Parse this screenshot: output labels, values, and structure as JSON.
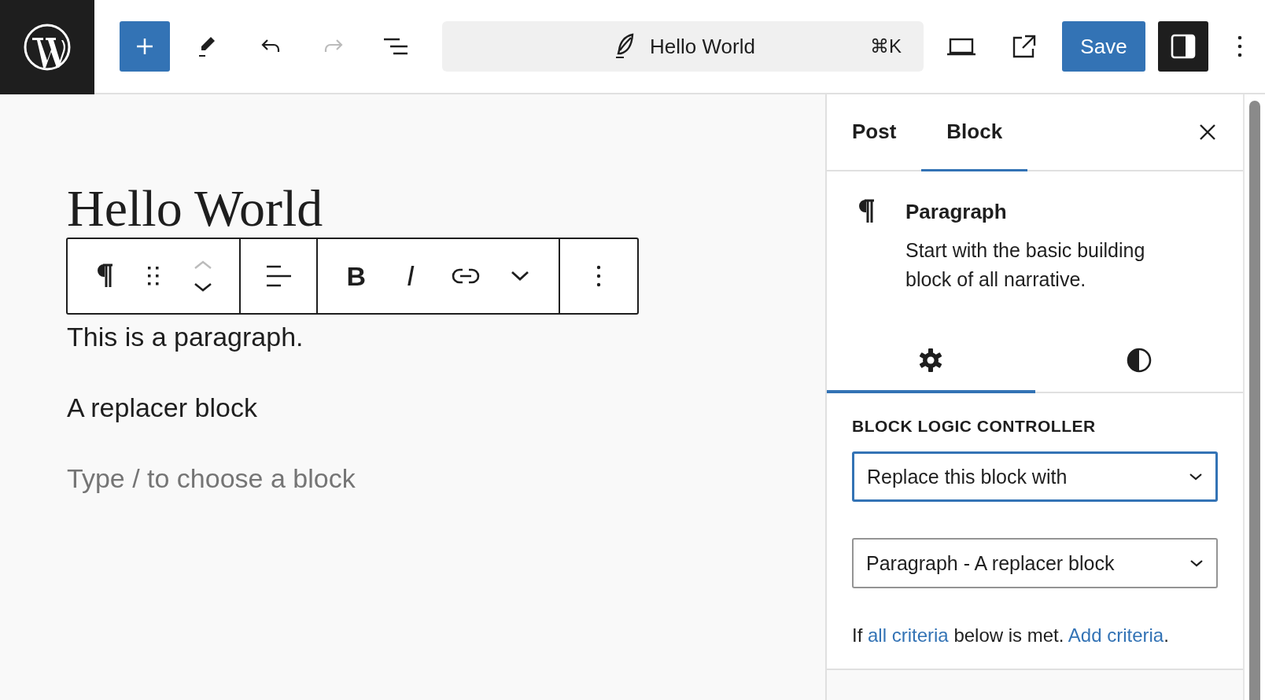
{
  "topbar": {
    "tools": [
      {
        "kind": "add",
        "disabled": false
      },
      {
        "kind": "edit",
        "disabled": false
      },
      {
        "kind": "undo",
        "disabled": false
      },
      {
        "kind": "redo",
        "disabled": true
      },
      {
        "kind": "list",
        "disabled": false
      }
    ],
    "command_bar": {
      "title": "Hello World",
      "shortcut": "⌘K"
    },
    "view_tools": [
      {
        "kind": "preview"
      },
      {
        "kind": "external"
      }
    ],
    "save_button": "Save",
    "settings_toggle": {
      "pressed": true
    }
  },
  "editor": {
    "title": "Hello World",
    "block_toolbar": [
      [
        {
          "kind": "paragraph"
        },
        {
          "kind": "drag"
        },
        {
          "kind": "move"
        }
      ],
      [
        {
          "kind": "align"
        }
      ],
      [
        {
          "kind": "bold",
          "label": "B"
        },
        {
          "kind": "italic",
          "label": "I"
        },
        {
          "kind": "link"
        },
        {
          "kind": "more"
        }
      ],
      [
        {
          "kind": "options"
        }
      ]
    ],
    "blocks": [
      {
        "kind": "paragraph",
        "text": "This is a paragraph."
      },
      {
        "kind": "paragraph",
        "text": "A replacer block"
      },
      {
        "kind": "placeholder",
        "text": "Type / to choose a block"
      }
    ]
  },
  "sidebar": {
    "tabs": [
      {
        "label": "Post",
        "selected": false
      },
      {
        "label": "Block",
        "selected": true
      }
    ],
    "block_card": {
      "title": "Paragraph",
      "description": "Start with the basic building block of all narrative."
    },
    "inspector_tabs": [
      {
        "kind": "settings",
        "selected": true
      },
      {
        "kind": "styles",
        "selected": false
      }
    ],
    "panel": {
      "heading": "BLOCK LOGIC CONTROLLER",
      "selects": [
        {
          "value": "Replace this block with",
          "focused": true
        },
        {
          "value": "Paragraph - A replacer block",
          "focused": false
        }
      ],
      "note": [
        {
          "kind": "text",
          "text": "If "
        },
        {
          "kind": "link",
          "text": "all criteria"
        },
        {
          "kind": "text",
          "text": " below is met. "
        },
        {
          "kind": "link",
          "text": "Add criteria"
        },
        {
          "kind": "text",
          "text": "."
        }
      ]
    }
  }
}
